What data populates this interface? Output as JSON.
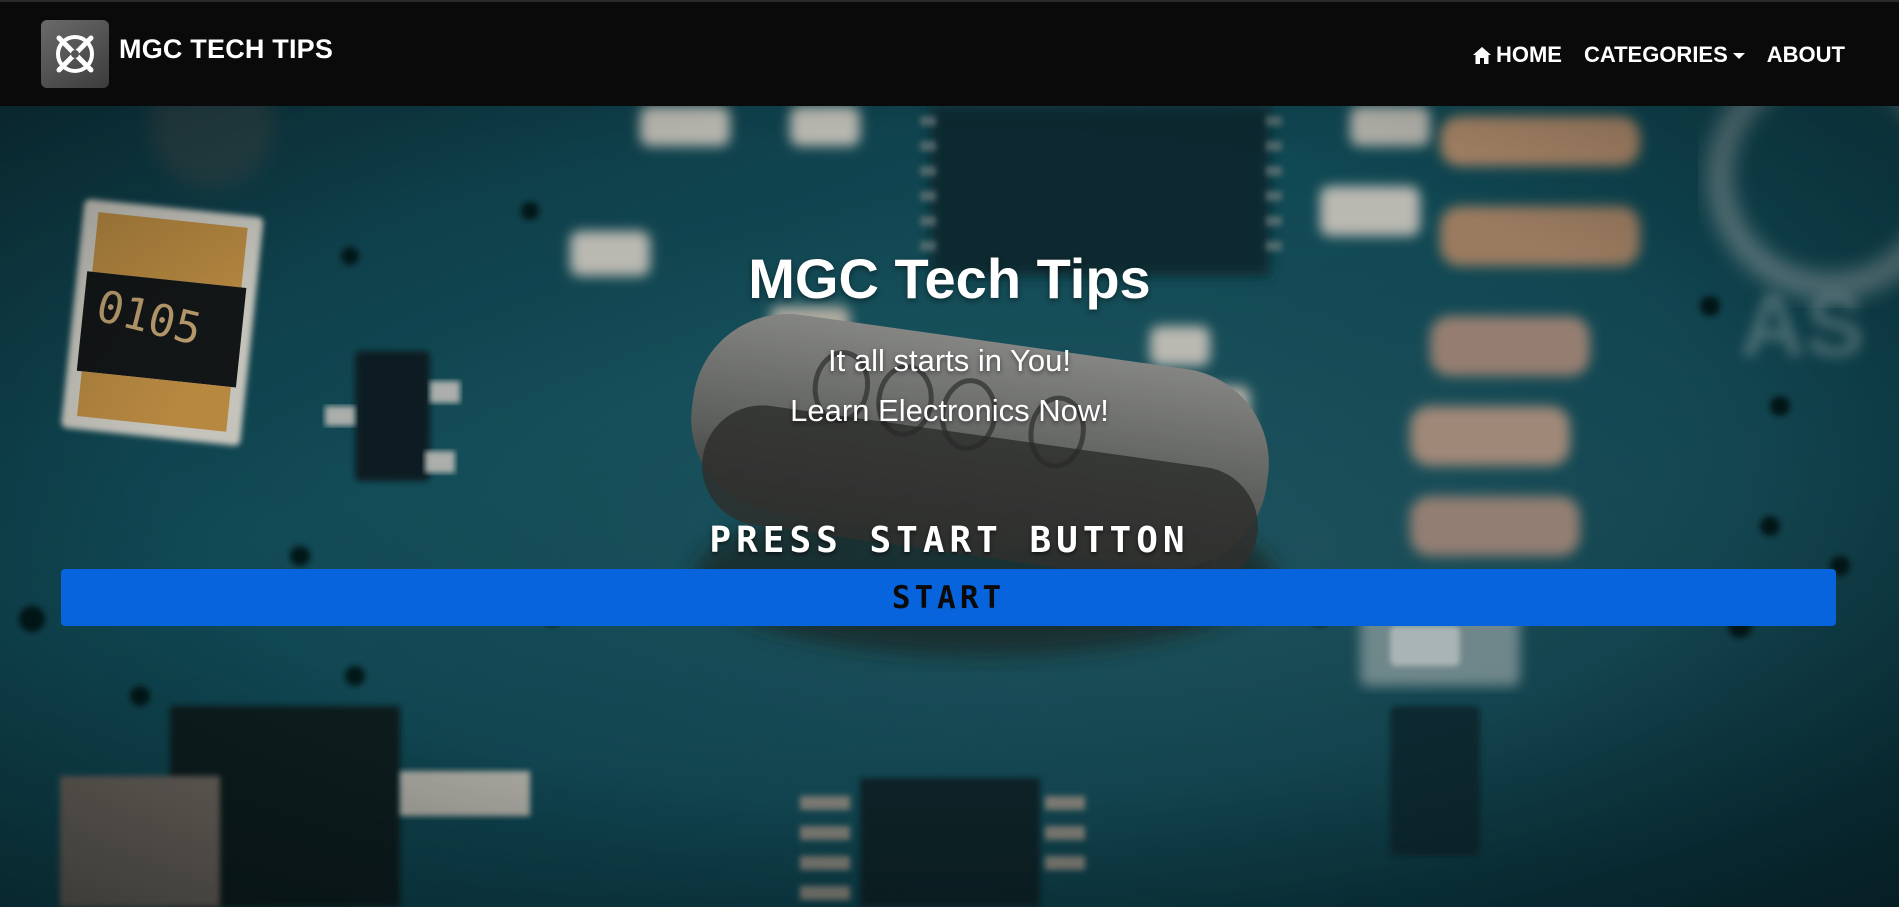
{
  "navbar": {
    "brand_text": "MGC TECH TIPS",
    "brand_logo_icon": "crossed-tools-icon",
    "links": [
      {
        "label": "HOME",
        "icon": "home-icon"
      },
      {
        "label": "CATEGORIES",
        "icon": "caret-down-icon"
      },
      {
        "label": "ABOUT"
      }
    ]
  },
  "hero": {
    "title": "MGC Tech Tips",
    "line1": "It all starts in You!",
    "line2": "Learn Electronics Now!",
    "press_text": "PRESS START BUTTON",
    "start_label": "START",
    "background": "circuit-board-photo"
  },
  "colors": {
    "navbar_bg": "#0a0a0a",
    "start_button": "#0764dc",
    "board_teal": "#11505c"
  }
}
